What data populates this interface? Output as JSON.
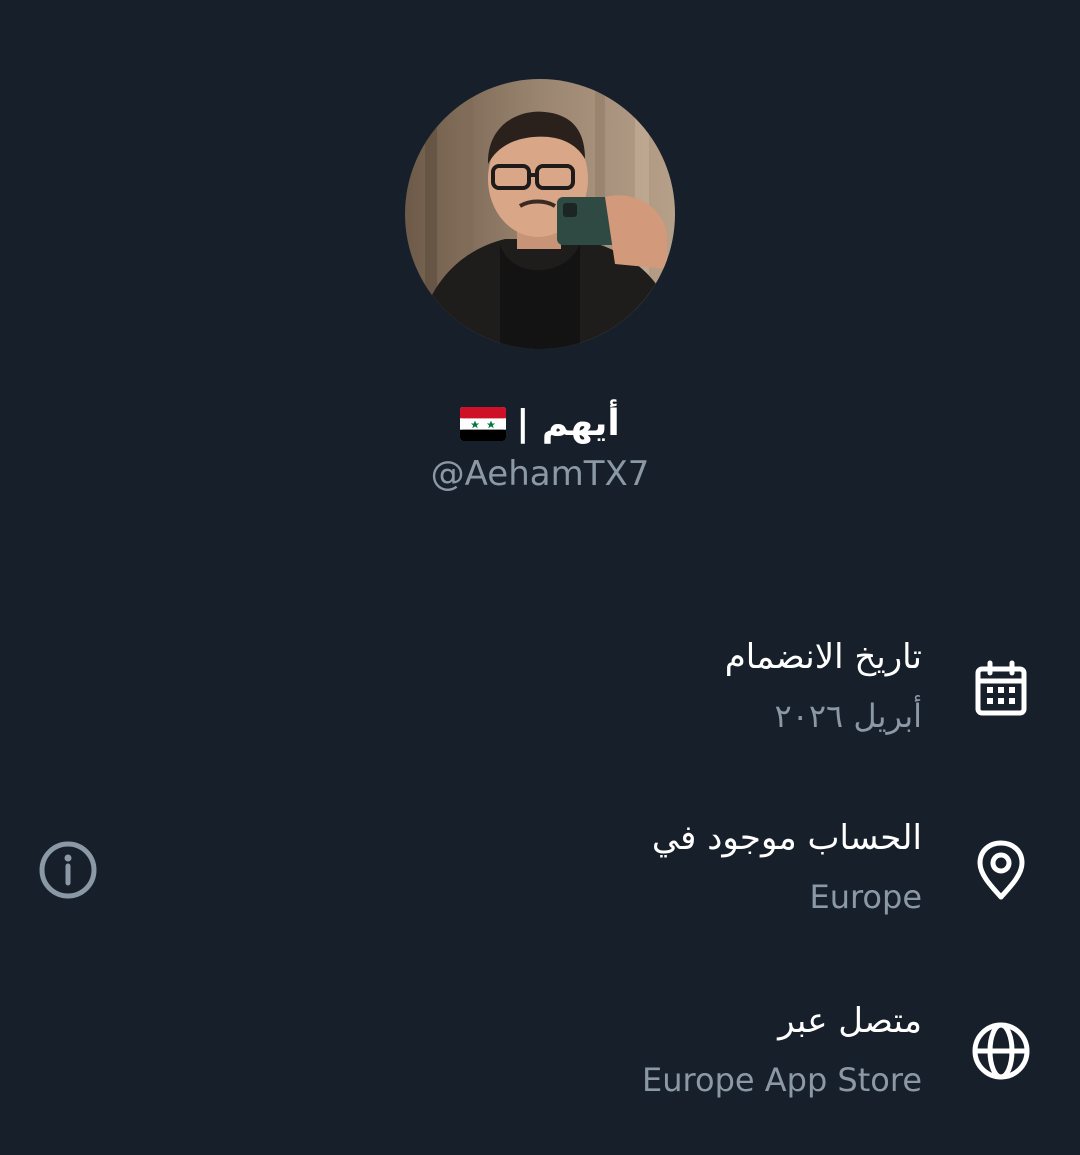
{
  "profile": {
    "display_name": "أيهم |",
    "handle": "@AehamTX7",
    "flag_icon": "syria-flag-icon",
    "avatar": "profile-photo"
  },
  "about": {
    "items": [
      {
        "title": "تاريخ الانضمام",
        "value": "أبريل ٢٠٢٦",
        "icon": "calendar-icon"
      },
      {
        "title": "الحساب موجود في",
        "value": "Europe",
        "icon": "location-pin-icon"
      },
      {
        "title": "متصل عبر",
        "value": "Europe App Store",
        "icon": "globe-icon"
      }
    ],
    "info_button_icon": "info-icon"
  },
  "colors": {
    "background": "#17202a",
    "primary_text": "#ffffff",
    "secondary_text": "#8b98a5"
  }
}
